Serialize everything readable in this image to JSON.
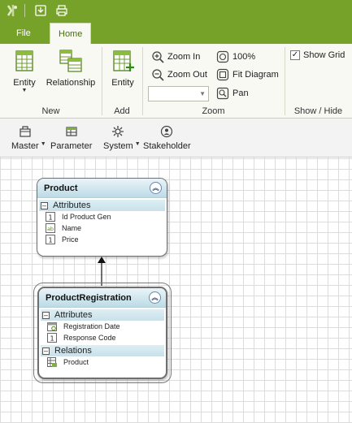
{
  "app": {
    "accent_color": "#76a22a",
    "quick_access": [
      {
        "icon": "app-logo-icon"
      },
      {
        "icon": "save-icon"
      },
      {
        "icon": "print-icon"
      }
    ]
  },
  "tabs": [
    {
      "label": "File",
      "active": false
    },
    {
      "label": "Home",
      "active": true
    }
  ],
  "ribbon": {
    "groups": {
      "new": {
        "label": "New",
        "entity_label": "Entity",
        "relationship_label": "Relationship"
      },
      "add": {
        "label": "Add",
        "entity_label": "Entity"
      },
      "zoom": {
        "label": "Zoom",
        "zoom_in": "Zoom In",
        "zoom_out": "Zoom Out",
        "hundred": "100%",
        "fit": "Fit Diagram",
        "pan": "Pan",
        "combo_value": ""
      },
      "show_hide": {
        "label": "Show / Hide",
        "show_grid_label": "Show Grid",
        "show_grid_checked": true
      }
    }
  },
  "toolbar": {
    "items": [
      {
        "label": "Master",
        "icon": "master-icon",
        "dropdown": true
      },
      {
        "label": "Parameter",
        "icon": "parameter-icon",
        "dropdown": false
      },
      {
        "label": "System",
        "icon": "system-icon",
        "dropdown": true
      },
      {
        "label": "Stakeholder",
        "icon": "stakeholder-icon",
        "dropdown": false
      }
    ]
  },
  "diagram": {
    "entities": [
      {
        "title": "Product",
        "sections": [
          {
            "label": "Attributes",
            "rows": [
              {
                "icon": "key-numeric-icon",
                "label": "Id Product Gen"
              },
              {
                "icon": "text-field-icon",
                "label": "Name"
              },
              {
                "icon": "numeric-field-icon",
                "label": "Price"
              }
            ]
          }
        ]
      },
      {
        "title": "ProductRegistration",
        "sections": [
          {
            "label": "Attributes",
            "rows": [
              {
                "icon": "date-field-icon",
                "label": "Registration Date"
              },
              {
                "icon": "numeric-field-icon",
                "label": "Response Code"
              }
            ]
          },
          {
            "label": "Relations",
            "rows": [
              {
                "icon": "relation-table-icon",
                "label": "Product"
              }
            ]
          }
        ]
      }
    ]
  }
}
